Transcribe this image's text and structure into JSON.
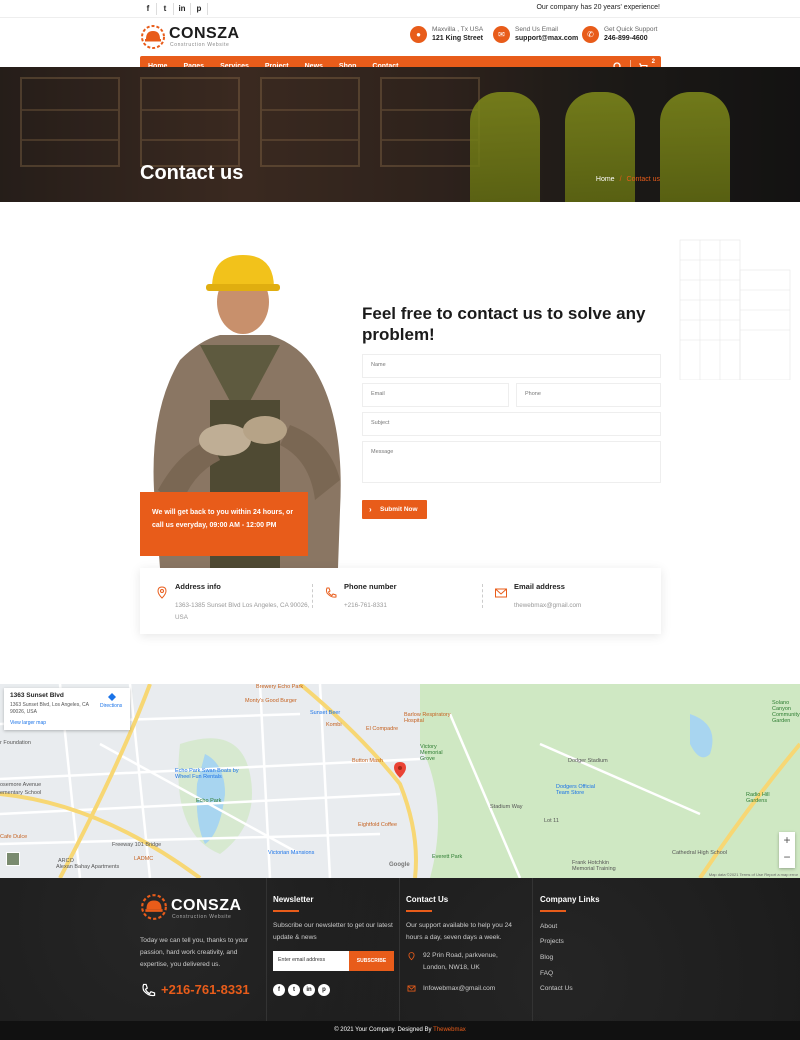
{
  "topbar": {
    "social": [
      "f",
      "t",
      "in",
      "p"
    ],
    "message": "Our company has 20 years' experience!"
  },
  "brand": {
    "name": "CONSZA",
    "tagline": "Construction Website"
  },
  "header_info": [
    {
      "icon": "location-pin-icon",
      "line1": "Maxvilla , Tx USA",
      "line2": "121 King Street"
    },
    {
      "icon": "email-icon",
      "line1": "Send Us Email",
      "line2": "support@max.com"
    },
    {
      "icon": "phone-icon",
      "line1": "Get Quick Support",
      "line2": "246-899-4600"
    }
  ],
  "nav": {
    "items": [
      "Home",
      "Pages",
      "Services",
      "Project",
      "News",
      "Shop",
      "Contact"
    ],
    "cart_count": "2"
  },
  "banner": {
    "title": "Contact us",
    "breadcrumb_home": "Home",
    "breadcrumb_sep": "/",
    "breadcrumb_current": "Contact us"
  },
  "contact": {
    "callout": "We will get back to you within 24 hours, or call us everyday, 09:00 AM - 12:00 PM",
    "form_title": "Feel free to contact us to solve any problem!",
    "name_placeholder": "Name",
    "email_placeholder": "Email",
    "phone_placeholder": "Phone",
    "subject_placeholder": "Subject",
    "message_placeholder": "Message",
    "submit_label": "Submit Now"
  },
  "info": [
    {
      "title": "Address info",
      "value": "1363-1385 Sunset Blvd Los Angeles, CA 90026, USA"
    },
    {
      "title": "Phone number",
      "value": "+216-761-8331"
    },
    {
      "title": "Email address",
      "value": "thewebmax@gmail.com"
    }
  ],
  "map": {
    "card_title": "1363 Sunset Blvd",
    "card_address": "1363 Sunset Blvd, Los Angeles, CA 90026, USA",
    "card_directions": "Directions",
    "card_link": "View larger map",
    "labels": {
      "brewery": "Brewery Echo Park",
      "montys": "Monty's Good Burger",
      "sunset_beer": "Sunset Beer",
      "kombi": "Kombi",
      "el_compadre": "El Compadre",
      "barlow": "Barlow Respiratory Hospital",
      "victory": "Victory Memorial Grove",
      "button_mash": "Button Mash",
      "foundation": "r Foundation",
      "echo_swan": "Echo Park Swan Boats by Wheel Fun Rentals",
      "echo_park": "Echo Park",
      "elem": "ementary School",
      "avenue": "osemore Avenue",
      "eightfold": "Eightfold Coffee",
      "victorian": "Victorian Mansions",
      "cafe": "Cafe Dulce",
      "freeway": "Freeway 101 Bridge",
      "ladmc": "LADMC",
      "arco": "ARCO",
      "alexan": "Alexan Bahay Apartments",
      "dodger": "Dodger Stadium",
      "dodgers_store": "Dodgers Official Team Store",
      "lot11": "Lot 11",
      "frank": "Frank Hotchkin Memorial Training",
      "everett": "Everett Park",
      "cathedral": "Cathedral High School",
      "radio_hill": "Radio Hill Gardens",
      "solano": "Solano Canyon Community Garden",
      "stadium_way": "Stadium Way"
    },
    "google": "Google",
    "credit": "Map data ©2021   Terms of Use   Report a map error"
  },
  "footer": {
    "about": "Today we can tell you, thanks to your passion, hard work creativity, and expertise, you delivered us.",
    "phone": "+216-761-8331",
    "newsletter_title": "Newsletter",
    "newsletter_text": "Subscribe our newsletter to get our latest update & news",
    "newsletter_placeholder": "Enter email address",
    "subscribe_label": "SUBSCRIBE",
    "social": [
      "f",
      "t",
      "in",
      "p"
    ],
    "contact_title": "Contact Us",
    "contact_text": "Our support available to help you 24 hours a day, seven days a week.",
    "contact_address": "92 Prin Road, parkvenue, London, NW18, UK",
    "contact_email": "Infowebmax@gmail.com",
    "links_title": "Company Links",
    "links": [
      "About",
      "Projects",
      "Blog",
      "FAQ",
      "Contact Us"
    ],
    "copyright": "© 2021 Your Company. Designed By",
    "designer": "Thewebmax"
  },
  "colors": {
    "accent": "#e85c1a",
    "dark": "#1c1c1c"
  }
}
